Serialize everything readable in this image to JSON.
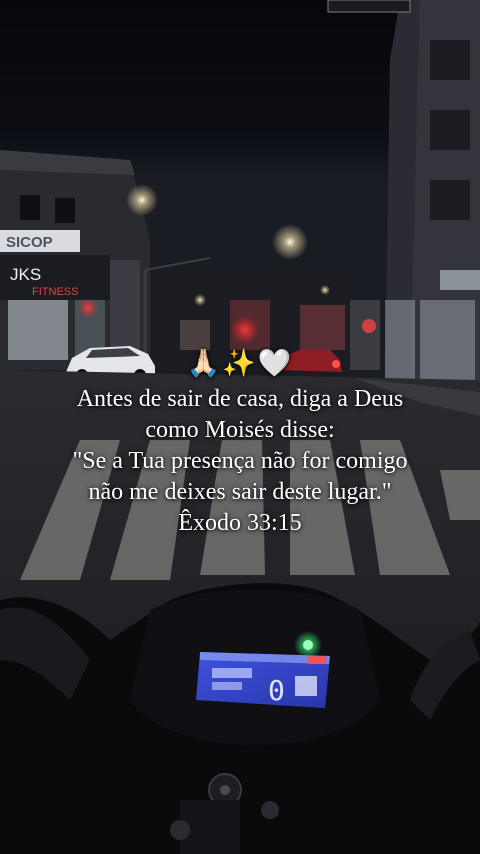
{
  "caption": {
    "emoji": {
      "hands": "🙏🏻",
      "sparkles": "✨",
      "heart": "🤍"
    },
    "lines": [
      "Antes de sair de casa, diga a Deus",
      "como Moisés disse:",
      "\"Se a Tua presença não for comigo",
      "não me deixes sair deste lugar.\"",
      "Êxodo 33:15"
    ]
  },
  "signs": {
    "store_1": "SICOP",
    "store_2": "JKS",
    "store_2_sub": "FITNESS"
  },
  "dashboard": {
    "gear": "0"
  },
  "colors": {
    "sky": "#07080c",
    "text": "#ffffff",
    "dash_screen": "#3b4fd0",
    "neutral_light": "#2fd36b"
  }
}
